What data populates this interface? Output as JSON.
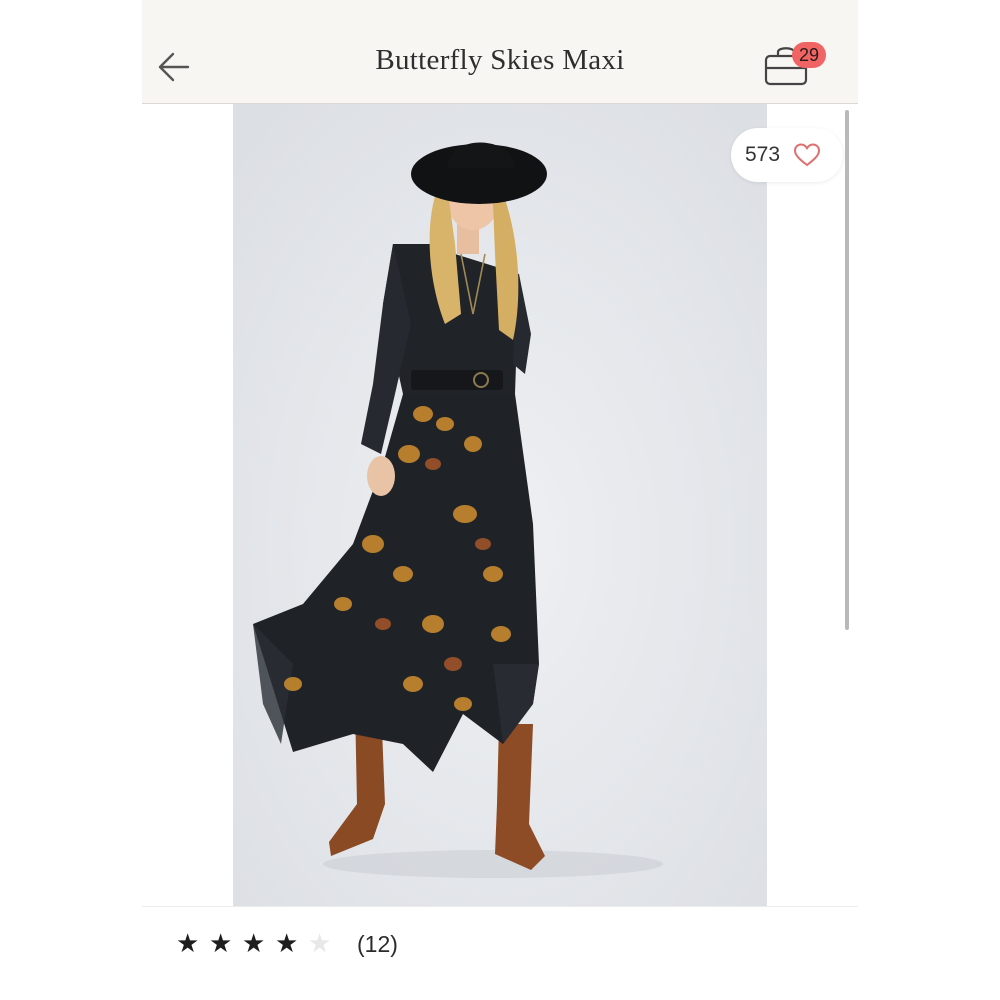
{
  "header": {
    "title": "Butterfly Skies Maxi",
    "bag_count": "29"
  },
  "favorites": {
    "count": "573"
  },
  "rating": {
    "stars_filled": 4,
    "stars_total": 5,
    "review_count": "(12)"
  },
  "icons": {
    "back": "arrow-left-icon",
    "bag": "shopping-bag-icon",
    "favorite": "heart-outline-icon",
    "star": "star-icon"
  },
  "colors": {
    "header_bg": "#f8f6f2",
    "badge": "#f06464",
    "heart": "#e07070",
    "image_bg": "#e4e6ea"
  }
}
